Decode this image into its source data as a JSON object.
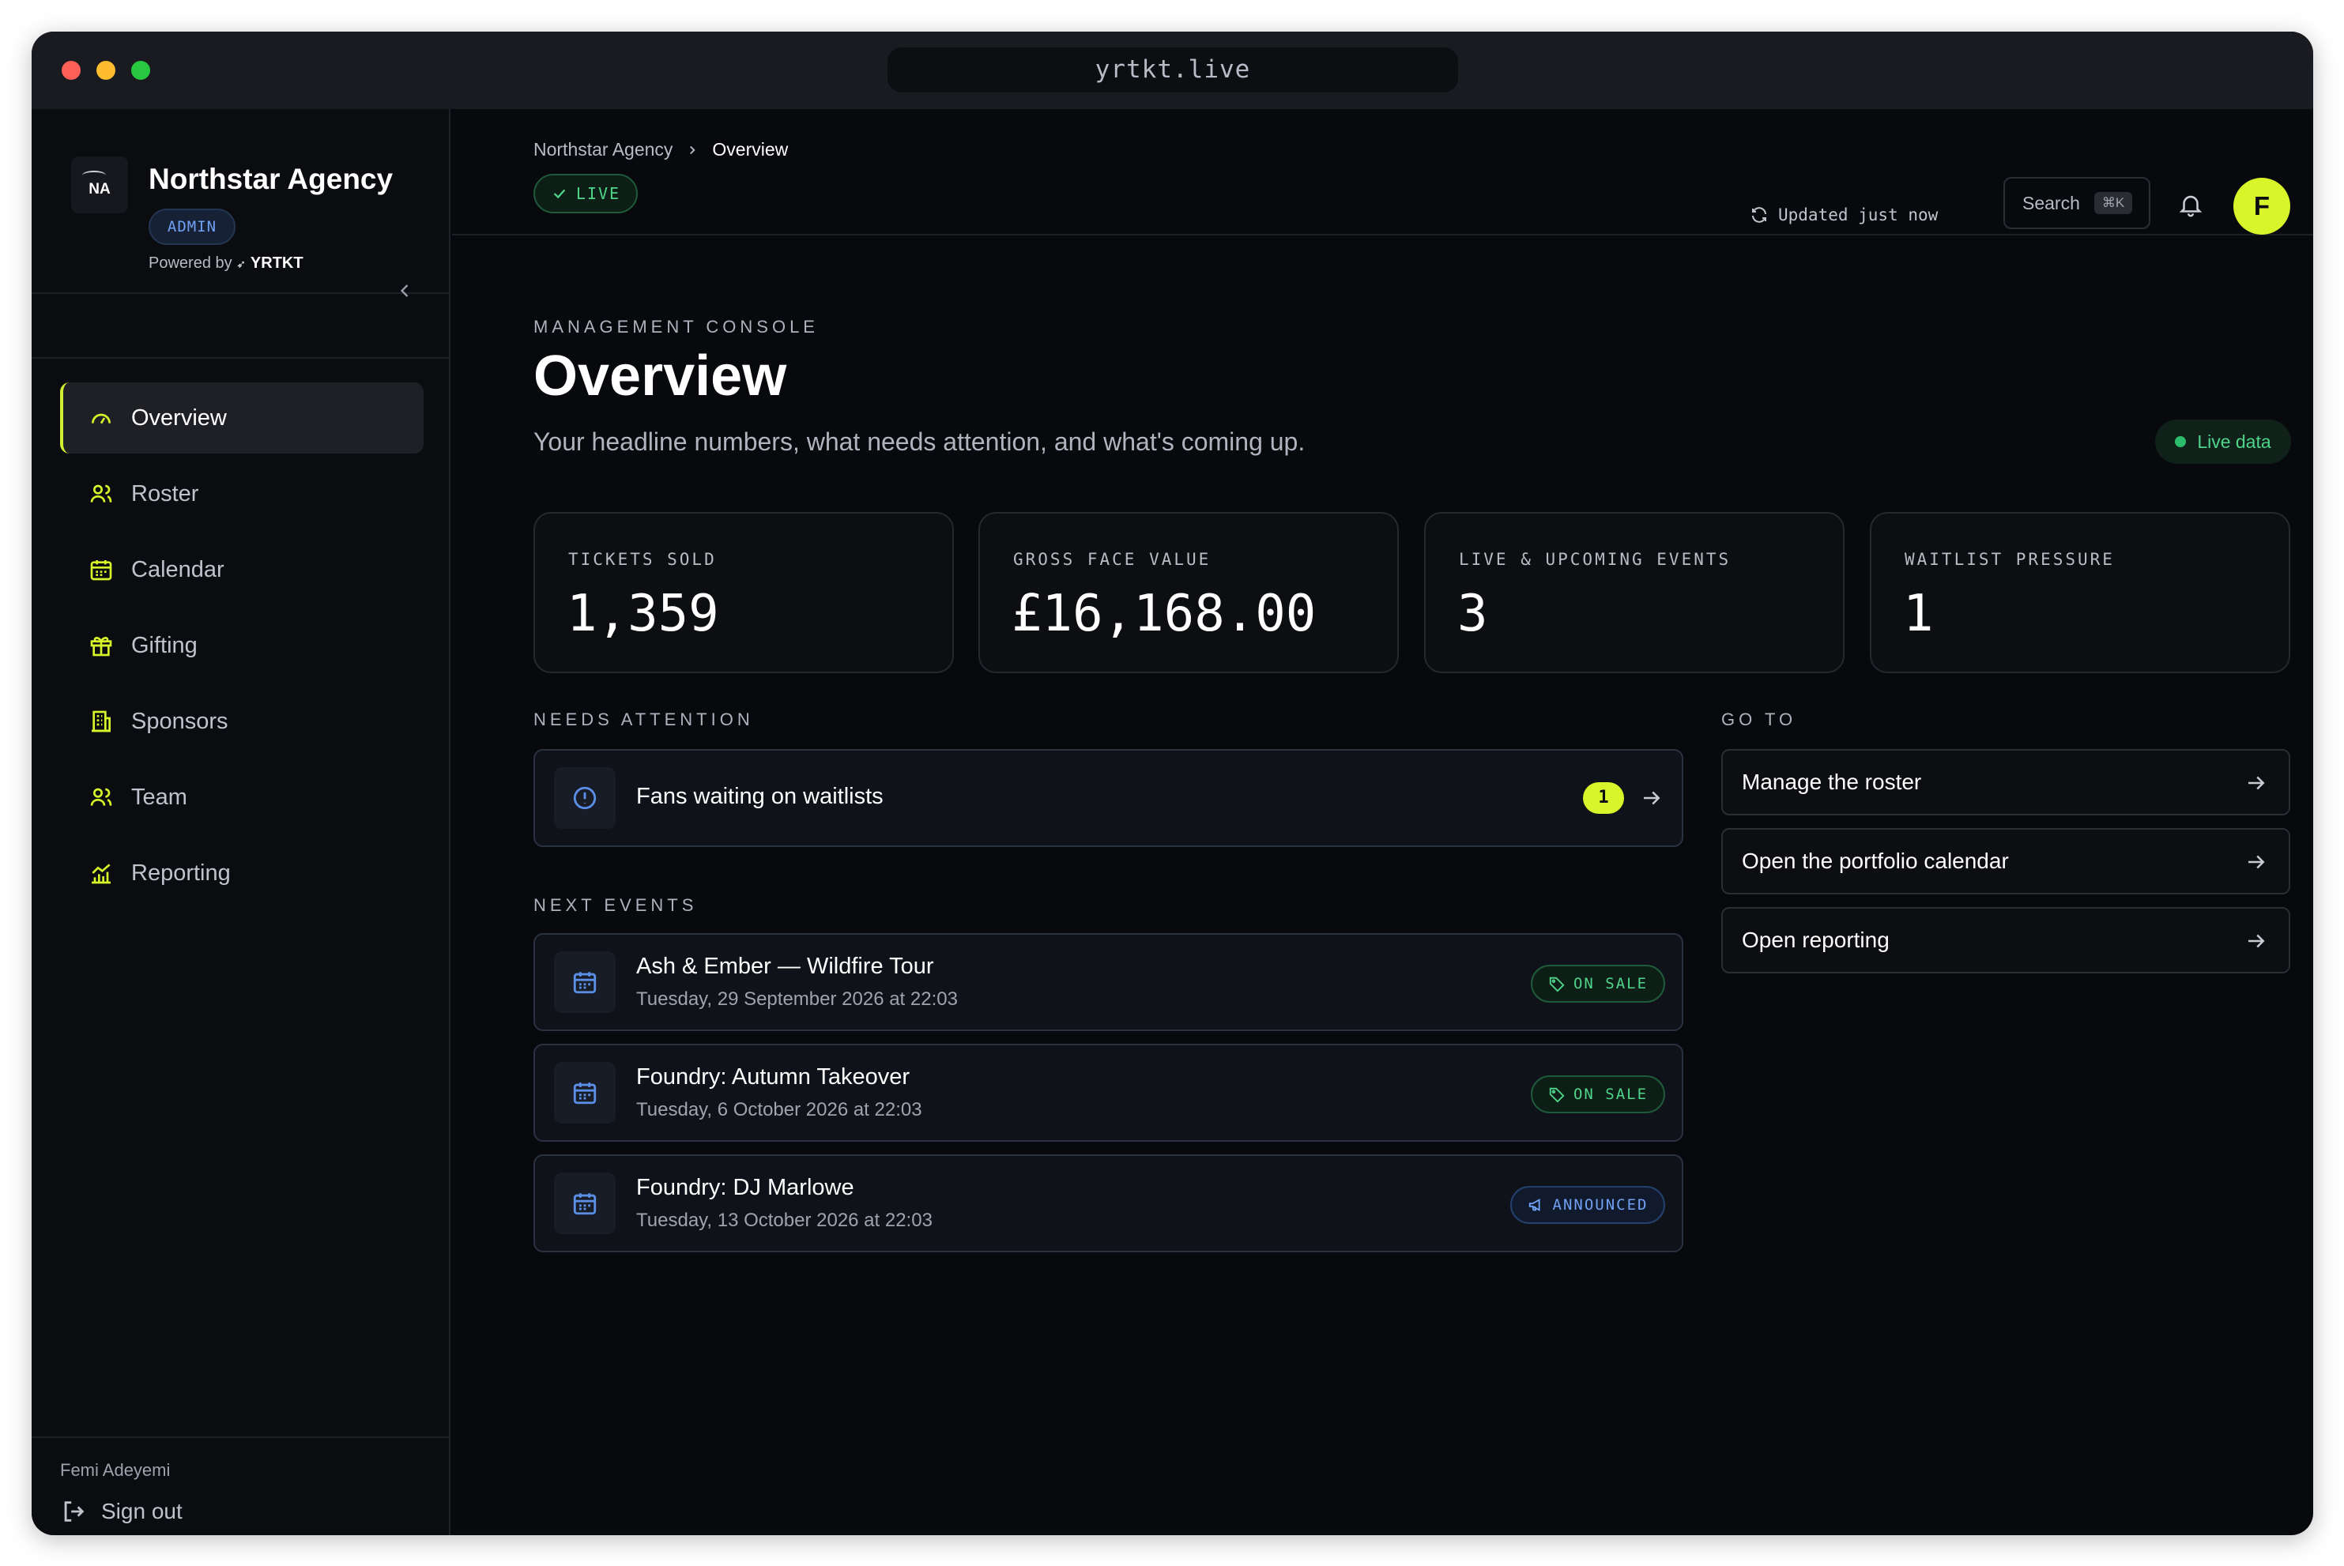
{
  "browser": {
    "url": "yrtkt.live"
  },
  "sidebar": {
    "brand": {
      "name": "Northstar Agency",
      "logo_text": "NA",
      "role": "ADMIN",
      "powered_by": "Powered by",
      "powered_brand": "YRTKT"
    },
    "collapse_icon": "chevron-left-icon",
    "items": [
      {
        "label": "Overview",
        "icon": "gauge-icon",
        "active": true
      },
      {
        "label": "Roster",
        "icon": "users-icon"
      },
      {
        "label": "Calendar",
        "icon": "calendar-icon"
      },
      {
        "label": "Gifting",
        "icon": "gift-icon"
      },
      {
        "label": "Sponsors",
        "icon": "building-icon"
      },
      {
        "label": "Team",
        "icon": "team-icon"
      },
      {
        "label": "Reporting",
        "icon": "chart-icon"
      }
    ],
    "user": "Femi Adeyemi",
    "sign_out": "Sign out"
  },
  "header": {
    "breadcrumb": [
      "Northstar Agency",
      "Overview"
    ],
    "live_badge": "LIVE",
    "updated": "Updated just now",
    "search_label": "Search",
    "search_shortcut": "⌘K",
    "avatar_initial": "F"
  },
  "page": {
    "eyebrow": "MANAGEMENT CONSOLE",
    "title": "Overview",
    "subtitle": "Your headline numbers, what needs attention, and what's coming up.",
    "live_data": "Live data"
  },
  "stats": [
    {
      "label": "TICKETS SOLD",
      "value": "1,359"
    },
    {
      "label": "GROSS FACE VALUE",
      "value": "£16,168.00"
    },
    {
      "label": "LIVE & UPCOMING EVENTS",
      "value": "3"
    },
    {
      "label": "WAITLIST PRESSURE",
      "value": "1"
    }
  ],
  "needs_attention": {
    "heading": "NEEDS ATTENTION",
    "items": [
      {
        "label": "Fans waiting on waitlists",
        "count": "1"
      }
    ]
  },
  "next_events": {
    "heading": "NEXT EVENTS",
    "items": [
      {
        "title": "Ash & Ember — Wildfire Tour",
        "date": "Tuesday, 29 September 2026 at 22:03",
        "status": "ON SALE"
      },
      {
        "title": "Foundry: Autumn Takeover",
        "date": "Tuesday, 6 October 2026 at 22:03",
        "status": "ON SALE"
      },
      {
        "title": "Foundry: DJ Marlowe",
        "date": "Tuesday, 13 October 2026 at 22:03",
        "status": "ANNOUNCED"
      }
    ]
  },
  "go_to": {
    "heading": "GO TO",
    "links": [
      "Manage the roster",
      "Open the portfolio calendar",
      "Open reporting"
    ]
  },
  "colors": {
    "accent": "#d8f52b",
    "live_green": "#4ed58a",
    "info_blue": "#6fa1f4",
    "background": "#08090d"
  }
}
